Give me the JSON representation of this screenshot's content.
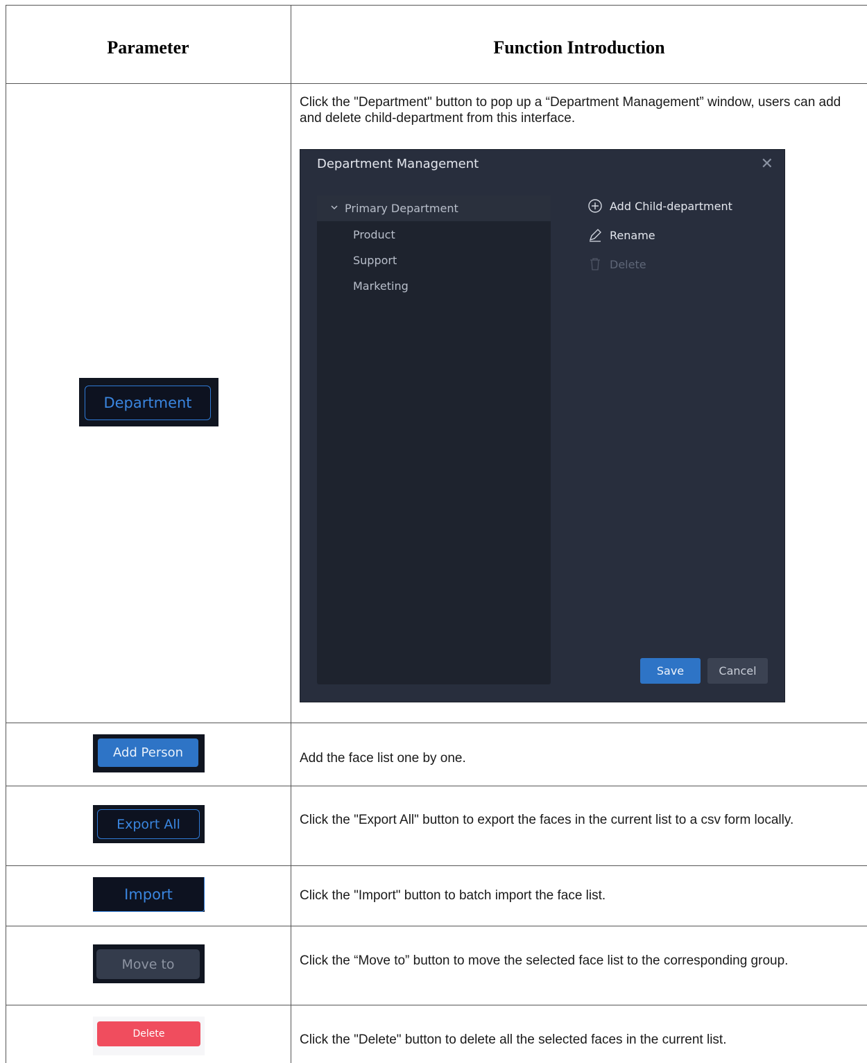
{
  "header": {
    "parameter": "Parameter",
    "function": "Function Introduction"
  },
  "rows": [
    {
      "button": "Department",
      "text": "Click the \"Department\" button to pop up a “Department Management” window, users can add and delete child-department from this interface."
    },
    {
      "button": "Add Person",
      "text": "Add the face list one by one."
    },
    {
      "button": "Export All",
      "text": "Click the \"Export All\" button to export the faces in the current list to a csv form locally."
    },
    {
      "button": "Import",
      "text": "Click the \"Import\" button to batch import the face list."
    },
    {
      "button": "Move to",
      "text": "Click the “Move to” button to move the selected face list to the corresponding group."
    },
    {
      "button": "Delete",
      "text": "Click the \"Delete\" button to delete all the selected faces in the current list."
    }
  ],
  "dialog": {
    "title": "Department Management",
    "tree": {
      "root": "Primary Department",
      "children": [
        "Product",
        "Support",
        "Marketing"
      ]
    },
    "actions": {
      "add": "Add Child-department",
      "rename": "Rename",
      "delete": "Delete"
    },
    "save": "Save",
    "cancel": "Cancel"
  },
  "colors": {
    "dialog_bg": "#282e3d",
    "primary_blue": "#2e74c6",
    "delete_red": "#f04d5e"
  }
}
